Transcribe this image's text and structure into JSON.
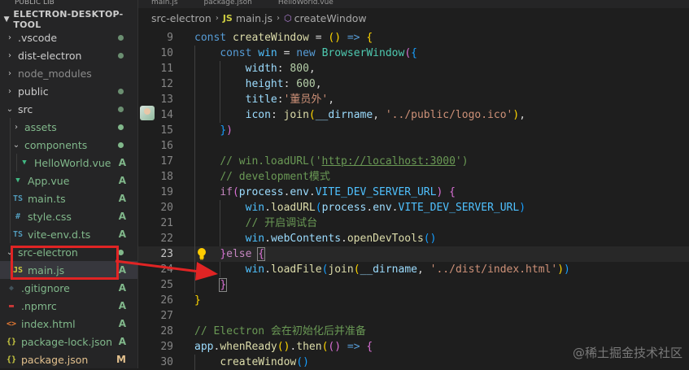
{
  "sidebar": {
    "top_strip_text": "PUBLIC LIB",
    "explorer_title": "ELECTRON-DESKTOP-TOOL",
    "items": [
      {
        "label": ".vscode",
        "kind": "folder",
        "expanded": false,
        "depth": 0,
        "status": "dot",
        "label_class": "untracked-dim"
      },
      {
        "label": "dist-electron",
        "kind": "folder",
        "expanded": false,
        "depth": 0,
        "status": "dot",
        "label_class": "untracked-dim"
      },
      {
        "label": "node_modules",
        "kind": "folder",
        "expanded": false,
        "depth": 0,
        "status": "",
        "label_class": "ignored"
      },
      {
        "label": "public",
        "kind": "folder",
        "expanded": false,
        "depth": 0,
        "status": "dot",
        "label_class": "untracked-dim"
      },
      {
        "label": "src",
        "kind": "folder",
        "expanded": true,
        "depth": 0,
        "status": "dot",
        "label_class": "untracked-dim"
      },
      {
        "label": "assets",
        "kind": "folder",
        "expanded": false,
        "depth": 1,
        "status": "dot",
        "label_class": "git-added"
      },
      {
        "label": "components",
        "kind": "folder",
        "expanded": true,
        "depth": 1,
        "status": "dot",
        "label_class": "git-added"
      },
      {
        "label": "HelloWorld.vue",
        "kind": "vue",
        "depth": 2,
        "status": "A",
        "label_class": "git-added"
      },
      {
        "label": "App.vue",
        "kind": "vue",
        "depth": 1,
        "status": "A",
        "label_class": "git-added"
      },
      {
        "label": "main.ts",
        "kind": "ts",
        "depth": 1,
        "status": "A",
        "label_class": "git-added"
      },
      {
        "label": "style.css",
        "kind": "css",
        "depth": 1,
        "status": "A",
        "label_class": "git-added"
      },
      {
        "label": "vite-env.d.ts",
        "kind": "ts",
        "depth": 1,
        "status": "A",
        "label_class": "git-added"
      },
      {
        "label": "src-electron",
        "kind": "folder",
        "expanded": true,
        "depth": 0,
        "status": "dot",
        "label_class": "git-added"
      },
      {
        "label": "main.js",
        "kind": "js",
        "depth": 1,
        "status": "A",
        "label_class": "git-added",
        "selected": true
      },
      {
        "label": ".gitignore",
        "kind": "git",
        "depth": 0,
        "status": "A",
        "label_class": "git-added"
      },
      {
        "label": ".npmrc",
        "kind": "npm",
        "depth": 0,
        "status": "A",
        "label_class": "git-added"
      },
      {
        "label": "index.html",
        "kind": "html",
        "depth": 0,
        "status": "A",
        "label_class": "git-added"
      },
      {
        "label": "package-lock.json",
        "kind": "json",
        "depth": 0,
        "status": "A",
        "label_class": "git-added"
      },
      {
        "label": "package.json",
        "kind": "json",
        "depth": 0,
        "status": "M",
        "label_class": "git-modified"
      }
    ]
  },
  "tabs_strip": [
    "main.js",
    "package.json",
    "HelloWorld.vue"
  ],
  "breadcrumbs": {
    "folder": "src-electron",
    "file": "main.js",
    "file_badge": "JS",
    "symbol": "createWindow"
  },
  "editor": {
    "current_line": 23,
    "lines": [
      {
        "n": 9,
        "indent": 0,
        "tokens": [
          [
            "kw",
            "const "
          ],
          [
            "fn",
            "createWindow"
          ],
          [
            "p",
            " = "
          ],
          [
            "b1",
            "("
          ],
          [
            "b1",
            ")"
          ],
          [
            "p",
            " "
          ],
          [
            "kw",
            "=>"
          ],
          [
            "p",
            " "
          ],
          [
            "b1",
            "{"
          ]
        ]
      },
      {
        "n": 10,
        "indent": 1,
        "tokens": [
          [
            "kw",
            "const "
          ],
          [
            "const",
            "win"
          ],
          [
            "p",
            " = "
          ],
          [
            "kw",
            "new "
          ],
          [
            "cls",
            "BrowserWindow"
          ],
          [
            "b2",
            "("
          ],
          [
            "b3",
            "{"
          ]
        ]
      },
      {
        "n": 11,
        "indent": 2,
        "tokens": [
          [
            "var",
            "width"
          ],
          [
            "p",
            ": "
          ],
          [
            "num",
            "800"
          ],
          [
            "p",
            ","
          ]
        ]
      },
      {
        "n": 12,
        "indent": 2,
        "tokens": [
          [
            "var",
            "height"
          ],
          [
            "p",
            ": "
          ],
          [
            "num",
            "600"
          ],
          [
            "p",
            ","
          ]
        ]
      },
      {
        "n": 13,
        "indent": 2,
        "tokens": [
          [
            "var",
            "title"
          ],
          [
            "p",
            ":"
          ],
          [
            "str",
            "'董员外'"
          ],
          [
            "p",
            ","
          ]
        ]
      },
      {
        "n": 14,
        "indent": 2,
        "tokens": [
          [
            "var",
            "icon"
          ],
          [
            "p",
            ": "
          ],
          [
            "fn",
            "join"
          ],
          [
            "b1",
            "("
          ],
          [
            "var",
            "__dirname"
          ],
          [
            "p",
            ", "
          ],
          [
            "str",
            "'../public/logo.ico'"
          ],
          [
            "b1",
            ")"
          ],
          [
            "p",
            ","
          ]
        ]
      },
      {
        "n": 15,
        "indent": 1,
        "tokens": [
          [
            "b3",
            "}"
          ],
          [
            "b2",
            ")"
          ]
        ]
      },
      {
        "n": 16,
        "indent": 1,
        "tokens": []
      },
      {
        "n": 17,
        "indent": 1,
        "tokens": [
          [
            "cmt",
            "// win.loadURL('"
          ],
          [
            "url",
            "http://localhost:3000"
          ],
          [
            "cmt",
            "')"
          ]
        ]
      },
      {
        "n": 18,
        "indent": 1,
        "tokens": [
          [
            "cmt",
            "// development模式"
          ]
        ]
      },
      {
        "n": 19,
        "indent": 1,
        "tokens": [
          [
            "ctl",
            "if"
          ],
          [
            "b2",
            "("
          ],
          [
            "var",
            "process"
          ],
          [
            "p",
            "."
          ],
          [
            "var",
            "env"
          ],
          [
            "p",
            "."
          ],
          [
            "const",
            "VITE_DEV_SERVER_URL"
          ],
          [
            "b2",
            ")"
          ],
          [
            "p",
            " "
          ],
          [
            "b2",
            "{"
          ]
        ]
      },
      {
        "n": 20,
        "indent": 2,
        "tokens": [
          [
            "const",
            "win"
          ],
          [
            "p",
            "."
          ],
          [
            "fn",
            "loadURL"
          ],
          [
            "b3",
            "("
          ],
          [
            "var",
            "process"
          ],
          [
            "p",
            "."
          ],
          [
            "var",
            "env"
          ],
          [
            "p",
            "."
          ],
          [
            "const",
            "VITE_DEV_SERVER_URL"
          ],
          [
            "b3",
            ")"
          ]
        ]
      },
      {
        "n": 21,
        "indent": 2,
        "tokens": [
          [
            "cmt",
            "// 开启调试台"
          ]
        ]
      },
      {
        "n": 22,
        "indent": 2,
        "tokens": [
          [
            "const",
            "win"
          ],
          [
            "p",
            "."
          ],
          [
            "var",
            "webContents"
          ],
          [
            "p",
            "."
          ],
          [
            "fn",
            "openDevTools"
          ],
          [
            "b3",
            "("
          ],
          [
            "b3",
            ")"
          ]
        ]
      },
      {
        "n": 23,
        "indent": 1,
        "tokens": [
          [
            "b2",
            "}"
          ],
          [
            "ctl",
            "else"
          ],
          [
            "p",
            " "
          ],
          [
            "b2box",
            "{"
          ]
        ]
      },
      {
        "n": 24,
        "indent": 2,
        "tokens": [
          [
            "const",
            "win"
          ],
          [
            "p",
            "."
          ],
          [
            "fn",
            "loadFile"
          ],
          [
            "b3",
            "("
          ],
          [
            "fn",
            "join"
          ],
          [
            "b1",
            "("
          ],
          [
            "var",
            "__dirname"
          ],
          [
            "p",
            ", "
          ],
          [
            "str",
            "'../dist/index.html'"
          ],
          [
            "b1",
            ")"
          ],
          [
            "b3",
            ")"
          ]
        ]
      },
      {
        "n": 25,
        "indent": 1,
        "tokens": [
          [
            "b2box",
            "}"
          ]
        ]
      },
      {
        "n": 26,
        "indent": 0,
        "tokens": [
          [
            "b1",
            "}"
          ]
        ]
      },
      {
        "n": 27,
        "indent": 0,
        "tokens": []
      },
      {
        "n": 28,
        "indent": 0,
        "tokens": [
          [
            "cmt",
            "// Electron 会在初始化后并准备"
          ]
        ]
      },
      {
        "n": 29,
        "indent": 0,
        "tokens": [
          [
            "var",
            "app"
          ],
          [
            "p",
            "."
          ],
          [
            "fn",
            "whenReady"
          ],
          [
            "b1",
            "("
          ],
          [
            "b1",
            ")"
          ],
          [
            "p",
            "."
          ],
          [
            "fn",
            "then"
          ],
          [
            "b1",
            "("
          ],
          [
            "b2",
            "("
          ],
          [
            "b2",
            ")"
          ],
          [
            "p",
            " "
          ],
          [
            "kw",
            "=>"
          ],
          [
            "p",
            " "
          ],
          [
            "b2",
            "{"
          ]
        ]
      },
      {
        "n": 30,
        "indent": 1,
        "tokens": [
          [
            "fn",
            "createWindow"
          ],
          [
            "b3",
            "("
          ],
          [
            "b3",
            ")"
          ]
        ]
      }
    ]
  },
  "watermark": "@稀土掘金技术社区",
  "colors": {
    "annotation_red": "#e02424",
    "git_added": "#81b88b",
    "git_modified": "#e2c08d"
  }
}
